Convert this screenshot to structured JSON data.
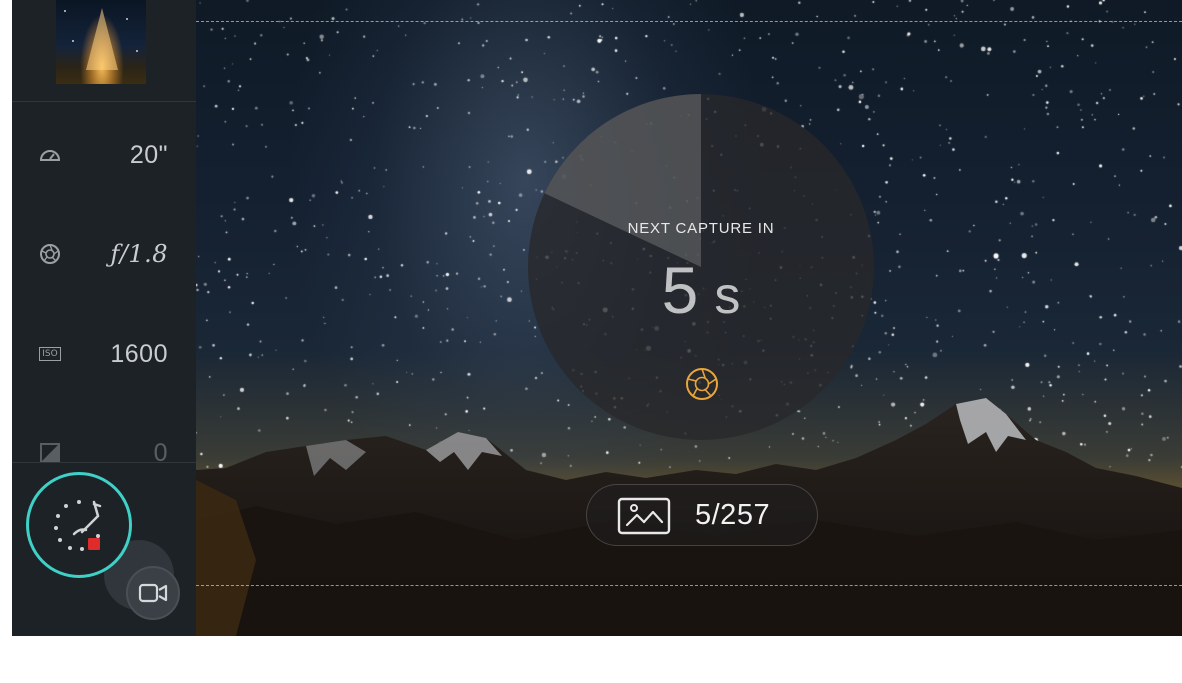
{
  "sidebar": {
    "settings": [
      {
        "icon": "shutter-speed-icon",
        "value": "20\""
      },
      {
        "icon": "aperture-icon",
        "value": "ƒ/1.8"
      },
      {
        "icon": "iso-icon",
        "label": "ISO",
        "value": "1600"
      },
      {
        "icon": "exposure-compensation-icon",
        "value": "0"
      }
    ],
    "mode_button": {
      "icon": "timelapse-icon",
      "recording_color": "#e02b2b"
    },
    "video_button": {
      "icon": "video-camera-icon"
    }
  },
  "viewfinder": {
    "timer": {
      "label": "NEXT CAPTURE IN",
      "value": "5",
      "unit": "s"
    },
    "counter": {
      "text": "5/257",
      "current": 5,
      "total": 257,
      "icon": "gallery-icon"
    }
  },
  "colors": {
    "accent": "#3fd0c8",
    "shutter_icon": "#e9a53a",
    "record": "#e02b2b",
    "sidebar_bg": "#1d2226"
  }
}
